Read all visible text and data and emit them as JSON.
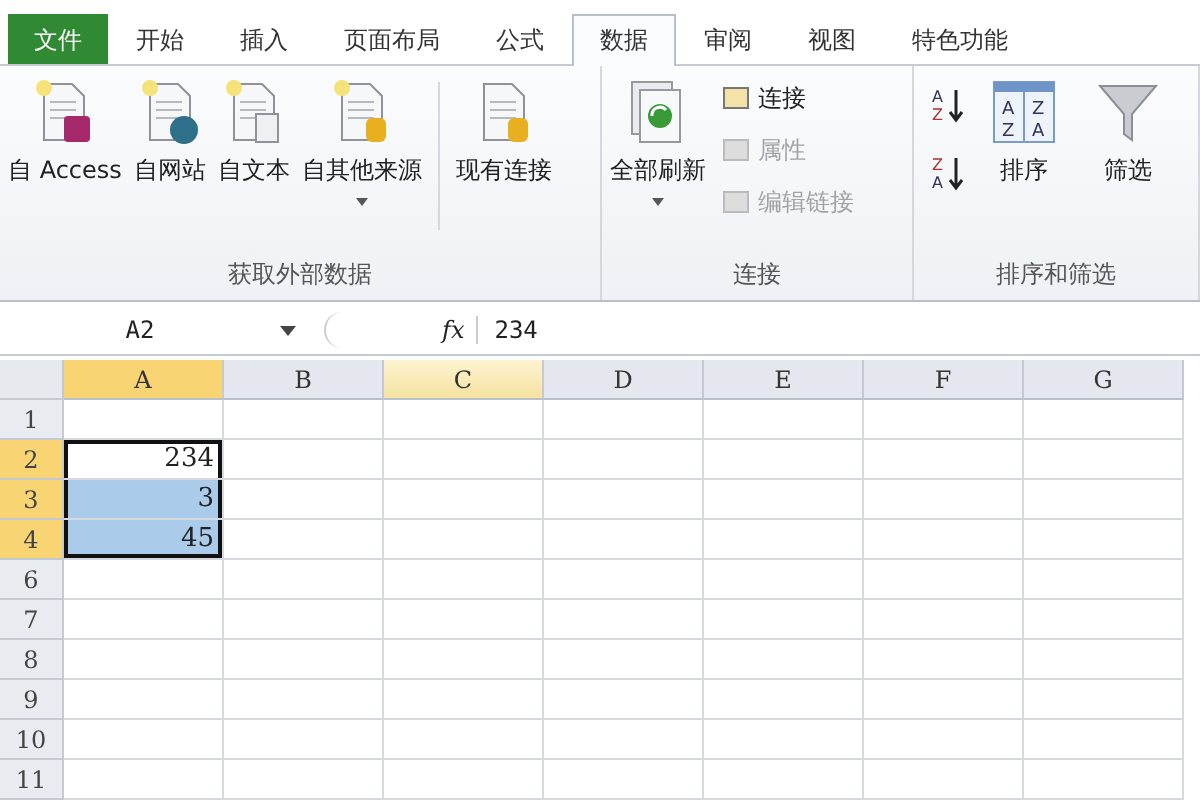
{
  "tabs": [
    {
      "label": "文件",
      "kind": "file",
      "selected": false
    },
    {
      "label": "开始",
      "kind": "normal",
      "selected": false
    },
    {
      "label": "插入",
      "kind": "normal",
      "selected": false
    },
    {
      "label": "页面布局",
      "kind": "normal",
      "selected": false
    },
    {
      "label": "公式",
      "kind": "normal",
      "selected": false
    },
    {
      "label": "数据",
      "kind": "normal",
      "selected": true
    },
    {
      "label": "审阅",
      "kind": "normal",
      "selected": false
    },
    {
      "label": "视图",
      "kind": "normal",
      "selected": false
    },
    {
      "label": "特色功能",
      "kind": "normal",
      "selected": false
    }
  ],
  "ribbon": {
    "groups": [
      {
        "label": "获取外部数据",
        "buttons": [
          {
            "kind": "large",
            "label": "自 Access",
            "dropdown": false,
            "disabled": false
          },
          {
            "kind": "large",
            "label": "自网站",
            "dropdown": false,
            "disabled": false
          },
          {
            "kind": "large",
            "label": "自文本",
            "dropdown": false,
            "disabled": false
          },
          {
            "kind": "large",
            "label": "自其他来源",
            "dropdown": true,
            "disabled": false
          },
          {
            "kind": "separator"
          },
          {
            "kind": "large",
            "label": "现有连接",
            "dropdown": false,
            "disabled": false
          }
        ]
      },
      {
        "label": "连接",
        "buttons": [
          {
            "kind": "large",
            "label": "全部刷新",
            "dropdown": true,
            "disabled": false
          },
          {
            "kind": "small",
            "label": "连接",
            "disabled": false
          },
          {
            "kind": "small",
            "label": "属性",
            "disabled": true
          },
          {
            "kind": "small",
            "label": "编辑链接",
            "disabled": true
          }
        ]
      },
      {
        "label": "排序和筛选",
        "buttons": [
          {
            "kind": "sorticons",
            "ascending": [
              "A",
              "Z"
            ],
            "descending": [
              "Z",
              "A"
            ]
          },
          {
            "kind": "sortgrid",
            "label": "排序",
            "icon_letters": [
              "A",
              "Z",
              "Z",
              "A"
            ],
            "dropdown": false,
            "disabled": false
          },
          {
            "kind": "large",
            "label": "筛选",
            "dropdown": false,
            "disabled": false
          }
        ]
      }
    ]
  },
  "formula_bar": {
    "name_box": "A2",
    "fx": "fx",
    "formula": "234"
  },
  "sheet": {
    "columns": [
      {
        "label": "A",
        "selected": true,
        "hover": false
      },
      {
        "label": "B",
        "selected": false,
        "hover": false
      },
      {
        "label": "C",
        "selected": false,
        "hover": true
      },
      {
        "label": "D",
        "selected": false,
        "hover": false
      },
      {
        "label": "E",
        "selected": false,
        "hover": false
      },
      {
        "label": "F",
        "selected": false,
        "hover": false
      },
      {
        "label": "G",
        "selected": false,
        "hover": false
      }
    ],
    "rows": [
      {
        "header": "1",
        "selected": false
      },
      {
        "header": "2",
        "selected": true,
        "cell_a": {
          "value": "234",
          "active": true
        }
      },
      {
        "header": "3",
        "selected": true,
        "cell_a": {
          "value": "3",
          "active": false
        }
      },
      {
        "header": "4",
        "selected": true,
        "cell_a": {
          "value": "45",
          "active": false
        }
      },
      {
        "header": "6",
        "selected": false
      },
      {
        "header": "7",
        "selected": false
      },
      {
        "header": "8",
        "selected": false
      },
      {
        "header": "9",
        "selected": false
      },
      {
        "header": "10",
        "selected": false
      },
      {
        "header": "11",
        "selected": false
      }
    ]
  }
}
